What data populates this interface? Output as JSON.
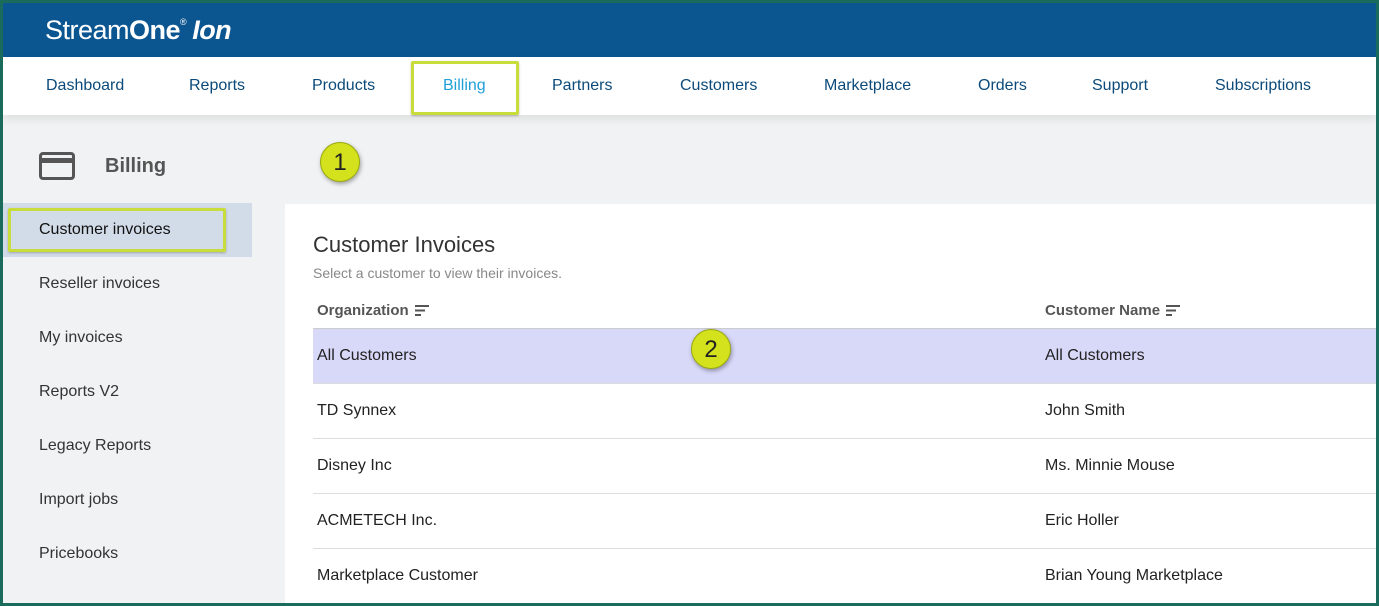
{
  "app": {
    "brand_part1": "Stream",
    "brand_part2": "One",
    "brand_reg": "®",
    "brand_part3": "Ion"
  },
  "nav": {
    "items": [
      {
        "label": "Dashboard"
      },
      {
        "label": "Reports"
      },
      {
        "label": "Products"
      },
      {
        "label": "Billing"
      },
      {
        "label": "Partners"
      },
      {
        "label": "Customers"
      },
      {
        "label": "Marketplace"
      },
      {
        "label": "Orders"
      },
      {
        "label": "Support"
      },
      {
        "label": "Subscriptions"
      }
    ],
    "active": "Billing"
  },
  "sidebar": {
    "title": "Billing",
    "icon": "credit-card-icon",
    "items": [
      {
        "label": "Customer invoices"
      },
      {
        "label": "Reseller invoices"
      },
      {
        "label": "My invoices"
      },
      {
        "label": "Reports V2"
      },
      {
        "label": "Legacy Reports"
      },
      {
        "label": "Import jobs"
      },
      {
        "label": "Pricebooks"
      }
    ]
  },
  "callouts": {
    "one": "1",
    "two": "2"
  },
  "main": {
    "title": "Customer Invoices",
    "subtitle": "Select a customer to view their invoices.",
    "columns": {
      "organization": "Organization",
      "customer_name": "Customer Name"
    },
    "rows": [
      {
        "organization": "All Customers",
        "customer_name": "All Customers"
      },
      {
        "organization": "TD Synnex",
        "customer_name": "John Smith"
      },
      {
        "organization": "Disney Inc",
        "customer_name": "Ms. Minnie Mouse"
      },
      {
        "organization": "ACMETECH Inc.",
        "customer_name": "Eric Holler"
      },
      {
        "organization": "Marketplace Customer",
        "customer_name": "Brian Young Marketplace"
      }
    ]
  },
  "colors": {
    "topbar": "#0b5591",
    "nav_text": "#0b4a7a",
    "nav_active": "#1fa0d9",
    "highlight_box": "#c8dc3c",
    "callout_badge": "#d3e21d",
    "selected_row": "#d8d8f9",
    "sidebar_active": "#d2dbe8"
  }
}
